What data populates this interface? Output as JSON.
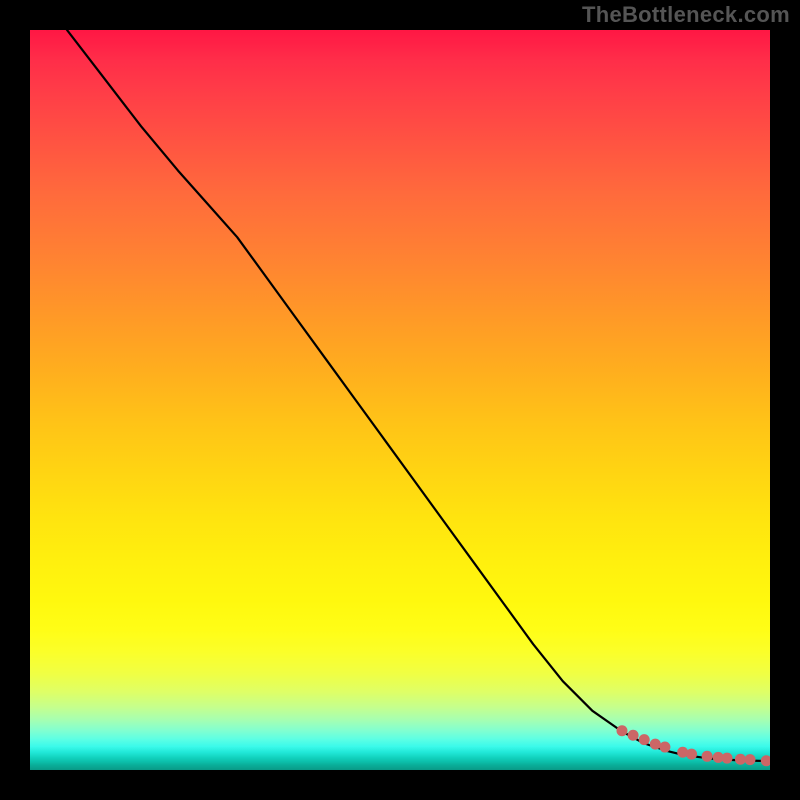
{
  "watermark": "TheBottleneck.com",
  "chart_data": {
    "type": "line",
    "title": "",
    "xlabel": "",
    "ylabel": "",
    "xlim": [
      0,
      100
    ],
    "ylim": [
      0,
      100
    ],
    "grid": false,
    "legend": false,
    "series": [
      {
        "name": "curve",
        "style": "line",
        "color": "#000000",
        "x": [
          5,
          10,
          15,
          20,
          24,
          28,
          32,
          36,
          40,
          44,
          48,
          52,
          56,
          60,
          64,
          68,
          72,
          76,
          80,
          83,
          86,
          88,
          90,
          92,
          94,
          96,
          98,
          100
        ],
        "y": [
          100,
          93.5,
          87,
          81,
          76.5,
          72,
          66.5,
          61,
          55.5,
          50,
          44.5,
          39,
          33.5,
          28,
          22.5,
          17,
          12,
          8,
          5.2,
          3.6,
          2.6,
          2.1,
          1.8,
          1.55,
          1.4,
          1.3,
          1.25,
          1.2
        ]
      },
      {
        "name": "points",
        "style": "scatter",
        "color": "#cc6666",
        "x": [
          80,
          81.5,
          83,
          84.5,
          85.8,
          88.2,
          89.4,
          91.5,
          93,
          94.2,
          96,
          97.3,
          99.5
        ],
        "y": [
          5.3,
          4.7,
          4.1,
          3.5,
          3.1,
          2.4,
          2.15,
          1.85,
          1.7,
          1.6,
          1.45,
          1.4,
          1.25
        ]
      }
    ],
    "gradient_background": {
      "orientation": "vertical",
      "stops": [
        {
          "pos": 0.0,
          "color": "#ff1744"
        },
        {
          "pos": 0.5,
          "color": "#ffc317"
        },
        {
          "pos": 0.8,
          "color": "#fffd16"
        },
        {
          "pos": 0.95,
          "color": "#5effe3"
        },
        {
          "pos": 1.0,
          "color": "#099a87"
        }
      ]
    }
  }
}
